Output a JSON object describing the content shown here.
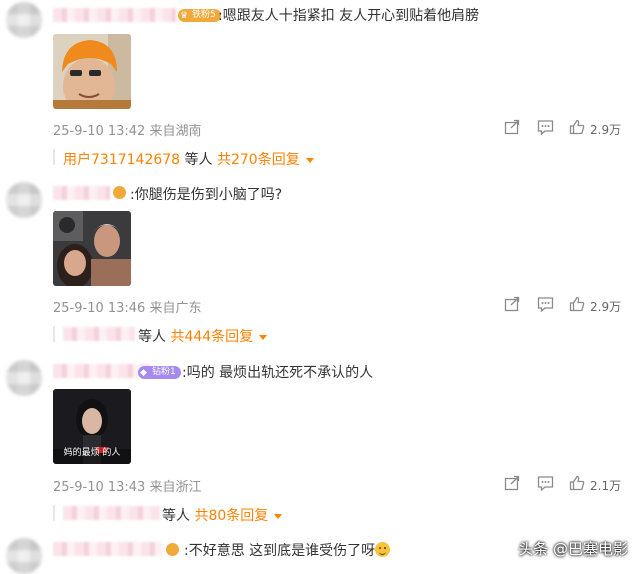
{
  "comments": [
    {
      "text": ":嗯跟友人十指紧扣 友人开心到贴着他肩膀",
      "badge": "铁粉5",
      "meta": "25-9-10 13:42 来自湖南",
      "likes": "2.9万",
      "reply_user": "用户7317142678",
      "reply_mid": " 等人 ",
      "reply_count": "共270条回复"
    },
    {
      "text": ":你腿伤是伤到小脑了吗?",
      "meta": "25-9-10 13:46 来自广东",
      "likes": "2.9万",
      "reply_mid": "等人 ",
      "reply_count": "共444条回复"
    },
    {
      "text": ":吗的 最烦出轨还死不承认的人",
      "badge": "钻粉1",
      "thumb_caption": "妈的最烦 的人",
      "meta": "25-9-10 13:43 来自浙江",
      "likes": "2.1万",
      "reply_mid": "等人 ",
      "reply_count": "共80条回复"
    },
    {
      "text": ":不好意思 这到底是谁受伤了呀"
    }
  ],
  "watermark": "头条 @巴塞电影",
  "colors": {
    "accent": "#ff8200",
    "meta": "#939393",
    "badge_gold": "#f2a93b",
    "badge_purple": "#a58af0"
  }
}
